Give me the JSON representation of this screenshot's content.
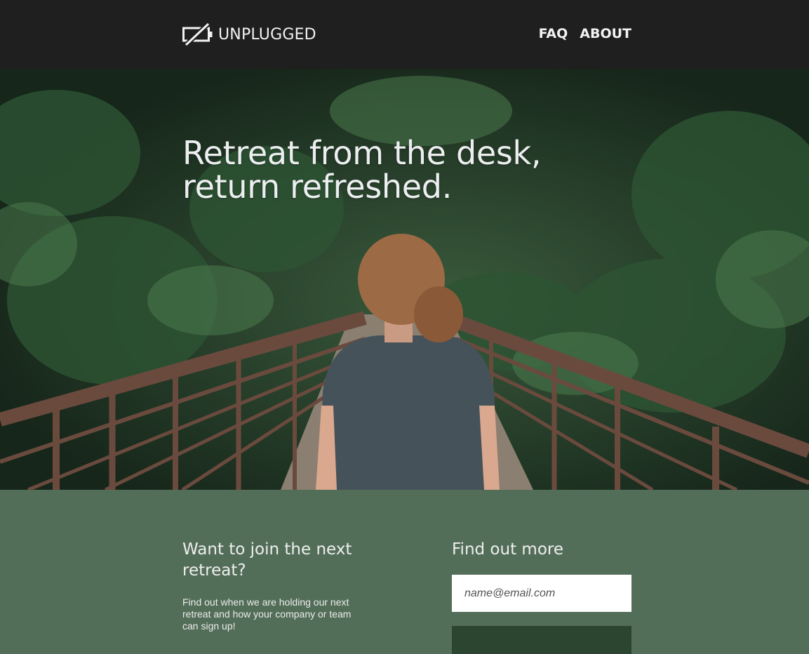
{
  "header": {
    "brand": "UNPLUGGED",
    "brand_icon": "battery-slash-icon",
    "nav": [
      {
        "label": "FAQ"
      },
      {
        "label": "ABOUT"
      }
    ]
  },
  "hero": {
    "title_line1": "Retreat from the desk,",
    "title_line2": "return refreshed.",
    "image_icon": "forest-bridge-photo"
  },
  "signup": {
    "join_heading": "Want to join the next retreat?",
    "join_text": "Find out when we are holding our next retreat and how your company or team can sign up!",
    "more_heading": "Find out more",
    "email_placeholder": "name@email.com"
  },
  "colors": {
    "header_bg": "#1f1f1f",
    "section_bg": "#536e58",
    "button_bg": "#2b4531",
    "bridge": "#6b4a3e"
  }
}
